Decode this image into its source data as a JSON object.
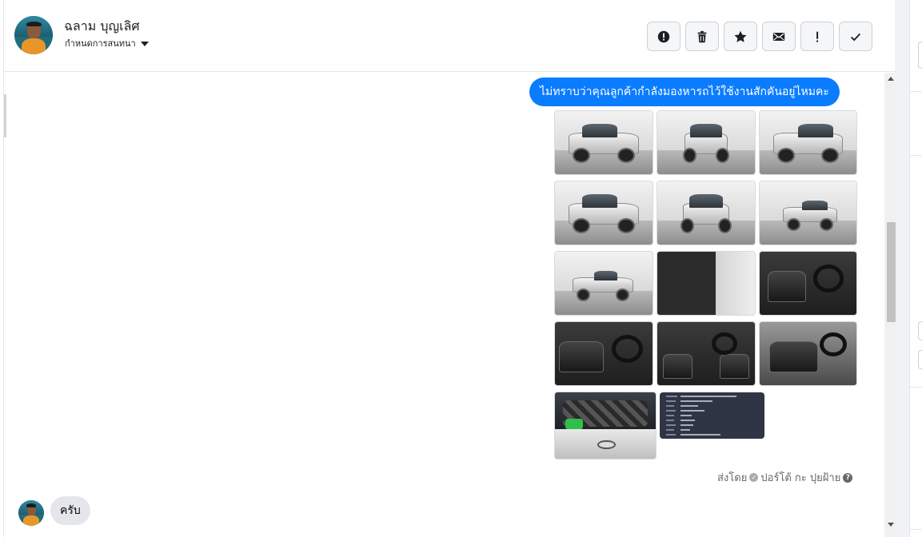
{
  "header": {
    "contact_name": "ฉลาม บุญเลิศ",
    "assign_label": "กำหนดการสนทนา",
    "actions": [
      {
        "name": "spam-button",
        "icon": "exclamation-circle-icon"
      },
      {
        "name": "delete-button",
        "icon": "trash-icon"
      },
      {
        "name": "star-button",
        "icon": "star-icon"
      },
      {
        "name": "mark-unread-button",
        "icon": "envelope-icon"
      },
      {
        "name": "follow-up-button",
        "icon": "exclamation-icon"
      },
      {
        "name": "mark-done-button",
        "icon": "checkmark-icon"
      }
    ]
  },
  "conversation": {
    "outgoing_message": "ไม่ทราบว่าคุณลูกค้ากำลังมองหารถไว้ใช้งานสักคันอยู่ไหมคะ",
    "photo_count": 14,
    "sender_prefix": "ส่งโดย",
    "sender_name": "ปอร์โต้ กะ ปุยฝ้าย",
    "help_glyph": "?",
    "incoming_message": "ครับ"
  },
  "colors": {
    "outgoing_bubble": "#0a7cff",
    "incoming_bubble": "#e4e6eb",
    "text_primary": "#1c1e21",
    "text_secondary": "#65676b"
  }
}
